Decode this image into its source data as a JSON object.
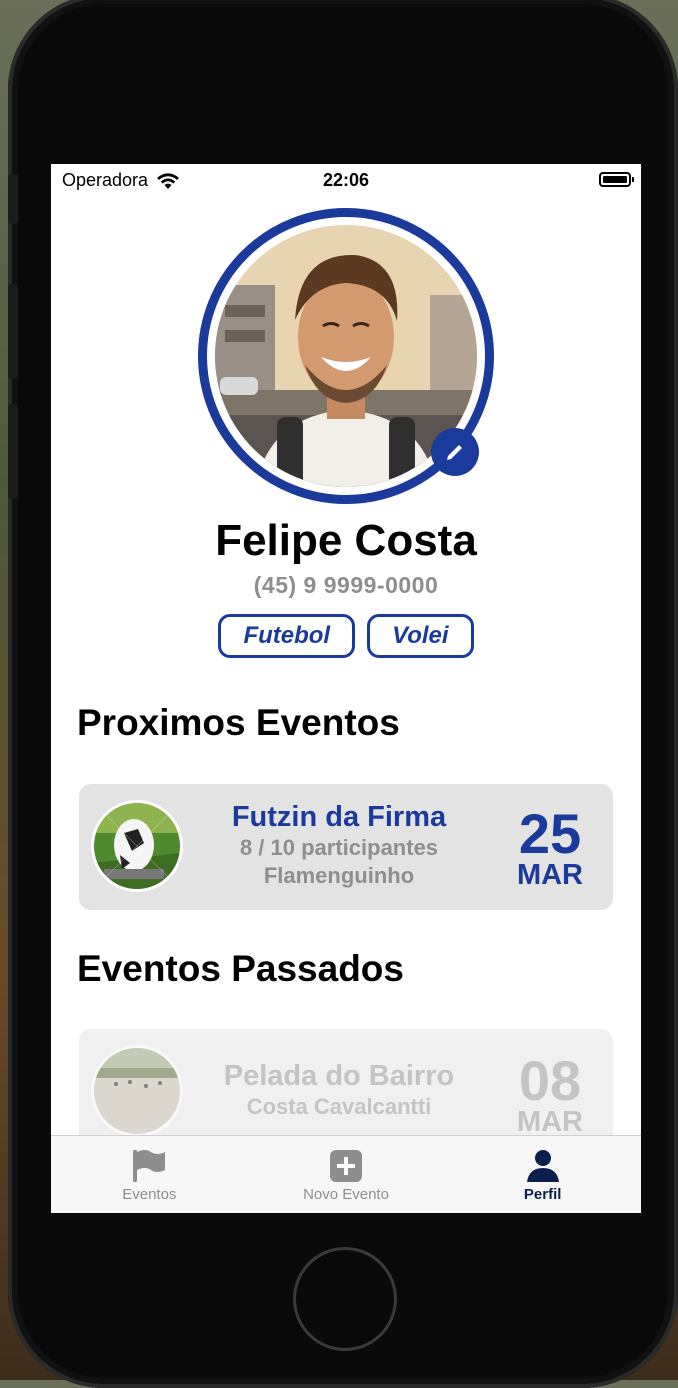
{
  "status_bar": {
    "carrier": "Operadora",
    "time": "22:06"
  },
  "profile": {
    "name": "Felipe Costa",
    "phone": "(45) 9 9999-0000",
    "tags": [
      "Futebol",
      "Volei"
    ]
  },
  "sections": {
    "upcoming_title": "Proximos Eventos",
    "past_title": "Eventos Passados"
  },
  "upcoming_events": [
    {
      "title": "Futzin da Firma",
      "participants": "8 / 10 participantes",
      "location": "Flamenguinho",
      "day": "25",
      "month": "MAR"
    }
  ],
  "past_events": [
    {
      "title": "Pelada do Bairro",
      "location": "Costa Cavalcantti",
      "day": "08",
      "month": "MAR"
    }
  ],
  "tab_bar": {
    "items": [
      {
        "label": "Eventos",
        "icon": "flag-icon"
      },
      {
        "label": "Novo Evento",
        "icon": "plus-square-icon"
      },
      {
        "label": "Perfil",
        "icon": "person-icon",
        "active": true
      }
    ]
  },
  "colors": {
    "accent": "#1a3a9c",
    "muted": "#8e8e8e",
    "active_tab": "#0b1f4f"
  }
}
